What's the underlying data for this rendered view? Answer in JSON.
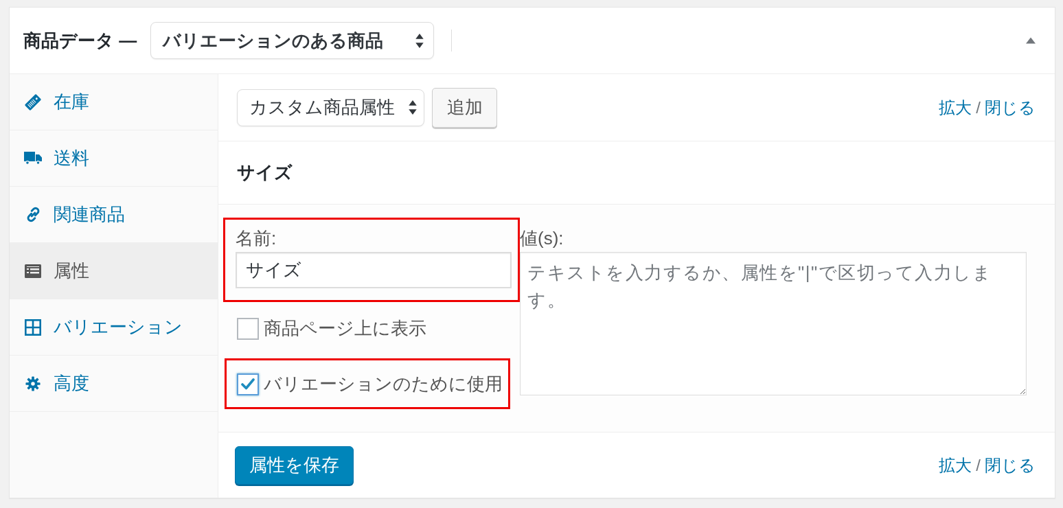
{
  "panel": {
    "title": "商品データ —",
    "product_type": {
      "value": "バリエーションのある商品"
    }
  },
  "sidebar": {
    "items": [
      {
        "label": "在庫",
        "selected": false
      },
      {
        "label": "送料",
        "selected": false
      },
      {
        "label": "関連商品",
        "selected": false
      },
      {
        "label": "属性",
        "selected": true
      },
      {
        "label": "バリエーション",
        "selected": false
      },
      {
        "label": "高度",
        "selected": false
      }
    ]
  },
  "toolbar": {
    "attribute_select": {
      "value": "カスタム商品属性"
    },
    "add_button": "追加",
    "links": {
      "expand": "拡大",
      "separator": "/",
      "close": "閉じる"
    }
  },
  "attribute": {
    "title": "サイズ",
    "name_field": {
      "label": "名前:",
      "value": "サイズ",
      "highlighted": true
    },
    "checkboxes": [
      {
        "label": "商品ページ上に表示",
        "checked": false,
        "highlighted": false
      },
      {
        "label": "バリエーションのために使用",
        "checked": true,
        "highlighted": true
      }
    ],
    "values_field": {
      "label": "値(s):",
      "placeholder": "テキストを入力するか、属性を\"|\"で区切って入力します。"
    }
  },
  "footer": {
    "save_button": "属性を保存",
    "links": {
      "expand": "拡大",
      "separator": "/",
      "close": "閉じる"
    }
  }
}
